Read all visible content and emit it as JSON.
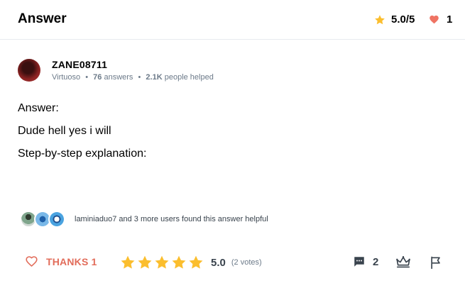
{
  "header": {
    "title": "Answer",
    "rating": "5.0/5",
    "likes": "1"
  },
  "author": {
    "name": "ZANE08711",
    "rank": "Virtuoso",
    "answers_count": "76",
    "answers_label": "answers",
    "helped_count": "2.1K",
    "helped_label": "people helped",
    "separator": "•"
  },
  "answer": {
    "lines": [
      "Answer:",
      "Dude hell yes i will",
      "Step-by-step explanation:"
    ]
  },
  "helpful": {
    "text": "laminiaduo7 and 3 more users found this answer helpful"
  },
  "actions": {
    "thanks_label": "THANKS 1",
    "score": "5.0",
    "votes": "(2 votes)",
    "stars_filled": 5,
    "comments_count": "2"
  },
  "colors": {
    "star": "#fbbe2e",
    "heart": "#ef7363",
    "thanks": "#e26c5a",
    "icon_dark": "#39434d"
  },
  "icons": {
    "header_star": "star-icon",
    "header_heart": "heart-icon",
    "thanks": "heart-outline-icon",
    "comments": "comment-icon",
    "crown": "crown-icon",
    "flag": "flag-icon"
  }
}
